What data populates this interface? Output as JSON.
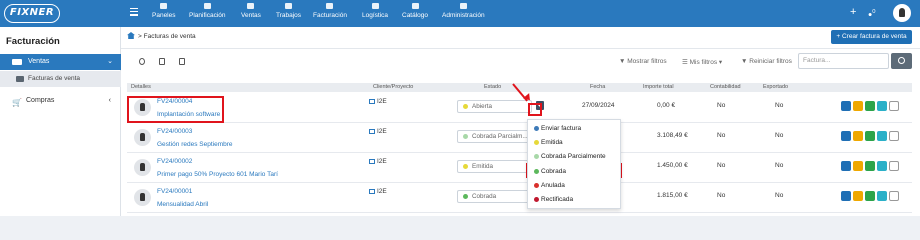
{
  "app": {
    "logo": "FIXNER"
  },
  "nav": [
    {
      "label": "Paneles"
    },
    {
      "label": "Planificación"
    },
    {
      "label": "Ventas"
    },
    {
      "label": "Trabajos"
    },
    {
      "label": "Facturación"
    },
    {
      "label": "Logística"
    },
    {
      "label": "Catálogo"
    },
    {
      "label": "Administración"
    }
  ],
  "topbar_right": {
    "plus": "+",
    "notif_badge": "0"
  },
  "sidebar": {
    "title": "Facturación",
    "ventas": "Ventas",
    "facturas_venta": "Facturas de venta",
    "compras": "Compras"
  },
  "breadcrumb": {
    "label": "Facturas de venta"
  },
  "new_button": "+ Crear factura de venta",
  "filters": {
    "mostrar": "Mostrar filtros",
    "mis": "Mis filtros",
    "reiniciar": "Reiniciar filtros",
    "search_placeholder": "Factura..."
  },
  "table": {
    "headers": {
      "detalles": "Detalles",
      "cliente": "Cliente/Proyecto",
      "estado": "Estado",
      "fecha": "Fecha",
      "importe": "Importe total",
      "contabilidad": "Contabilidad",
      "exportado": "Exportado"
    },
    "rows": [
      {
        "code": "FV24/00004",
        "desc": "Implantación software",
        "cliente": "I2E",
        "estado": "Abierta",
        "estado_color": "#e6d93a",
        "fecha": "27/09/2024",
        "importe": "0,00 €",
        "contabilidad": "No",
        "exportado": "No"
      },
      {
        "code": "FV24/00003",
        "desc": "Gestión redes Septiembre",
        "cliente": "I2E",
        "estado": "Cobrada Parcialm...",
        "estado_color": "#a8d8a8",
        "fecha": "",
        "importe": "3.108,49 €",
        "contabilidad": "No",
        "exportado": "No"
      },
      {
        "code": "FV24/00002",
        "desc": "Primer pago 50% Proyecto 601 Mario Tarí",
        "cliente": "I2E",
        "estado": "Emitida",
        "estado_color": "#e6d93a",
        "fecha": "",
        "importe": "1.450,00 €",
        "contabilidad": "No",
        "exportado": "No"
      },
      {
        "code": "FV24/00001",
        "desc": "Mensualidad Abril",
        "cliente": "I2E",
        "estado": "Cobrada",
        "estado_color": "#5cb85c",
        "fecha": "",
        "importe": "1.815,00 €",
        "contabilidad": "No",
        "exportado": "No"
      }
    ]
  },
  "action_colors": [
    "#1f6fb5",
    "#f0a800",
    "#2ca44a",
    "#2bb0c8"
  ],
  "menu": [
    {
      "label": "Enviar factura",
      "color": "#3d7ab8"
    },
    {
      "label": "Emitida",
      "color": "#e6d93a"
    },
    {
      "label": "Cobrada Parcialmente",
      "color": "#a8d8a8"
    },
    {
      "label": "Cobrada",
      "color": "#5cb85c"
    },
    {
      "label": "Anulada",
      "color": "#d9302c"
    },
    {
      "label": "Rectificada",
      "color": "#c0182e"
    }
  ],
  "highlight_color": "#e0141c"
}
